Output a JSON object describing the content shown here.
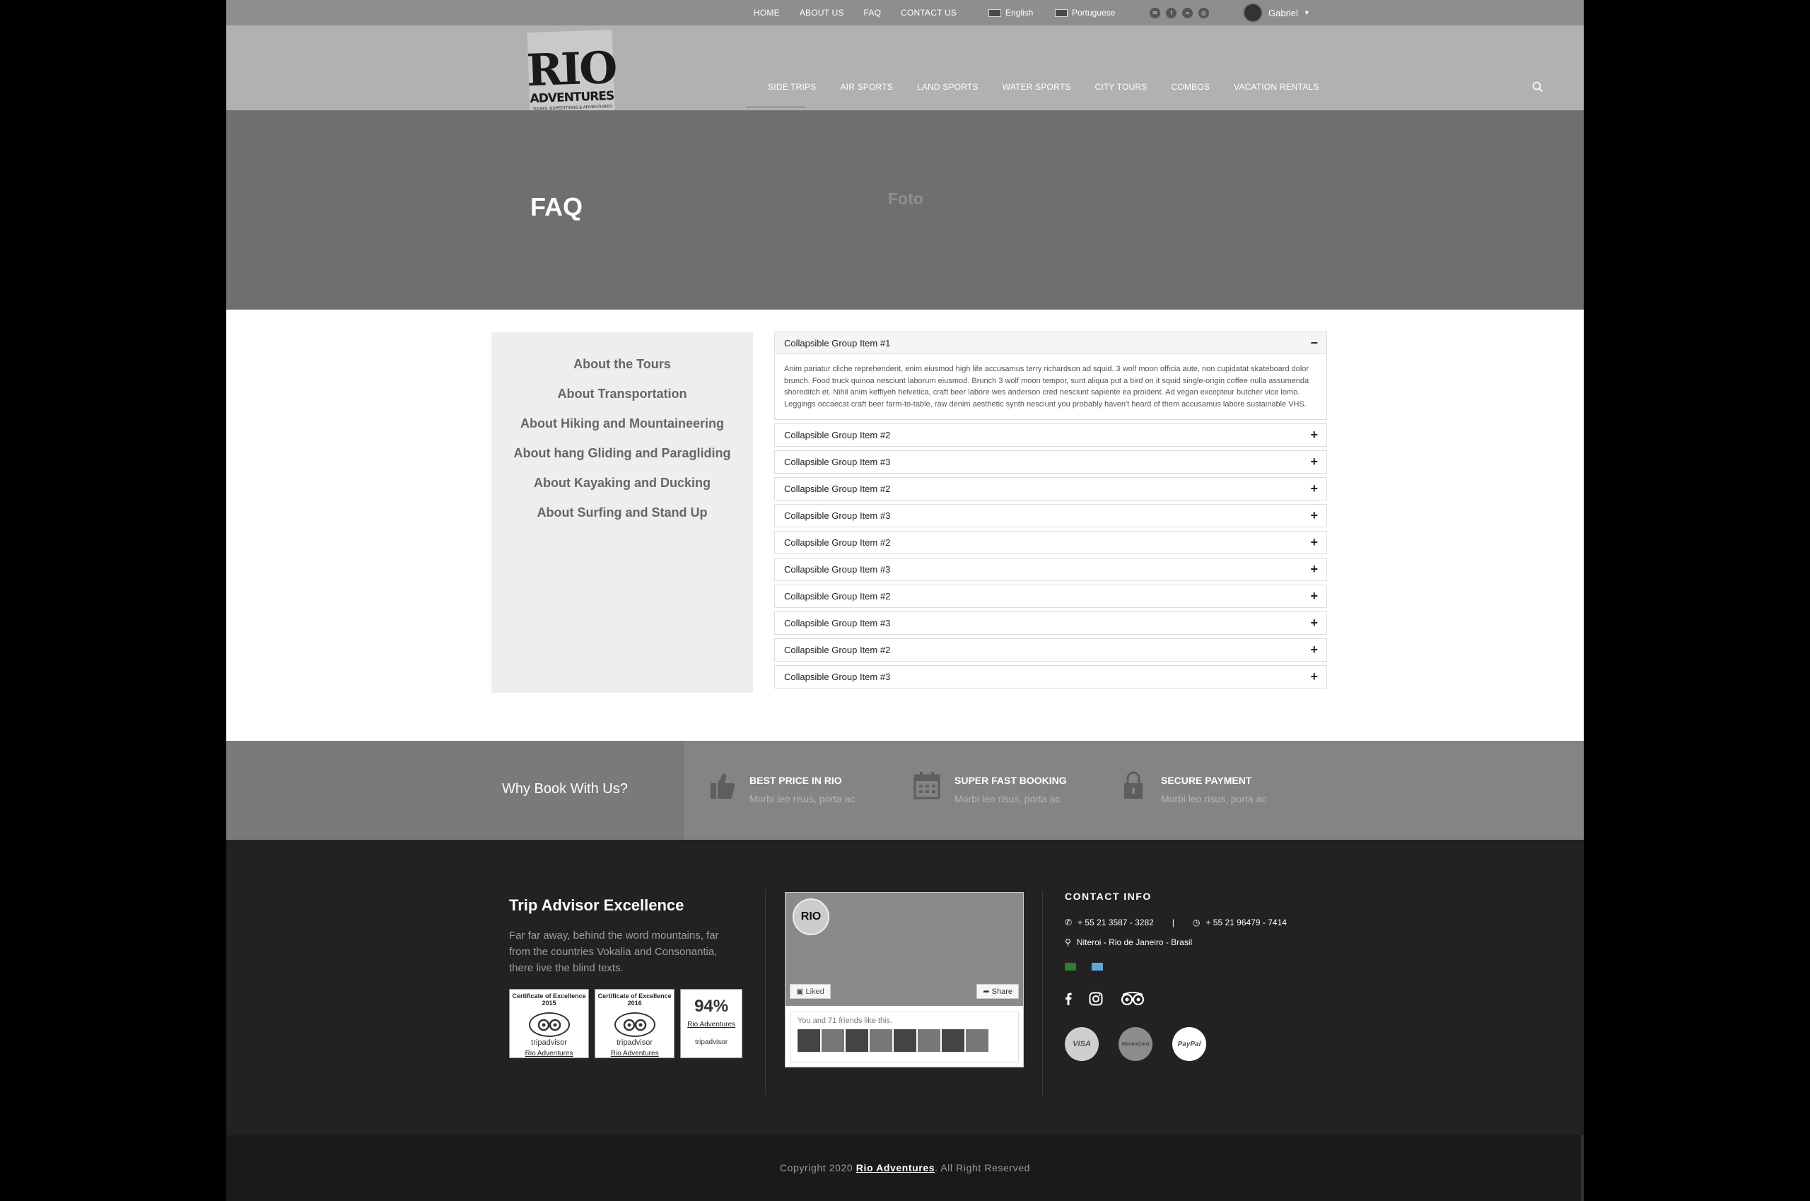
{
  "topbar": {
    "links": [
      "HOME",
      "ABOUT US",
      "FAQ",
      "CONTACT US"
    ],
    "lang_english": "English",
    "lang_portuguese": "Portuguese",
    "user_name": "Gabriel"
  },
  "logo": {
    "line1": "RIO",
    "line2": "ADVENTURES",
    "line3": "TOURS, EXPEDITIONS & ADVENTURES"
  },
  "nav": {
    "items": [
      "SIDE TRIPS",
      "AIR SPORTS",
      "LAND SPORTS",
      "WATER SPORTS",
      "CITY TOURS",
      "COMBOS",
      "VACATION RENTALS"
    ],
    "active": "SIDE TRIPS"
  },
  "hero": {
    "title": "FAQ",
    "image_placeholder": "Foto"
  },
  "sidebar": {
    "items": [
      "About the Tours",
      "About Transportation",
      "About Hiking and Mountaineering",
      "About hang Gliding and Paragliding",
      "About Kayaking and Ducking",
      "About Surfing and Stand Up"
    ]
  },
  "accordion": {
    "items": [
      {
        "title": "Collapsible Group Item #1",
        "open": true,
        "body": "Anim pariatur cliche reprehenderit, enim eiusmod high life accusamus terry richardson ad squid. 3 wolf moon officia aute, non cupidatat skateboard dolor brunch. Food truck quinoa nesciunt laborum eiusmod. Brunch 3 wolf moon tempor, sunt aliqua put a bird on it squid single-origin coffee nulla assumenda shoreditch et. Nihil anim keffiyeh helvetica, craft beer labore wes anderson cred nesciunt sapiente ea proident. Ad vegan excepteur butcher vice lomo. Leggings occaecat craft beer farm-to-table, raw denim aesthetic synth nesciunt you probably haven't heard of them accusamus labore sustainable VHS."
      },
      {
        "title": "Collapsible Group Item #2",
        "open": false
      },
      {
        "title": "Collapsible Group Item #3",
        "open": false
      },
      {
        "title": "Collapsible Group Item #2",
        "open": false
      },
      {
        "title": "Collapsible Group Item #3",
        "open": false
      },
      {
        "title": "Collapsible Group Item #2",
        "open": false
      },
      {
        "title": "Collapsible Group Item #3",
        "open": false
      },
      {
        "title": "Collapsible Group Item #2",
        "open": false
      },
      {
        "title": "Collapsible Group Item #3",
        "open": false
      },
      {
        "title": "Collapsible Group Item #2",
        "open": false
      },
      {
        "title": "Collapsible Group Item #3",
        "open": false
      }
    ],
    "open_symbol": "−",
    "closed_symbol": "+"
  },
  "whybook": {
    "title": "Why Book With Us?",
    "features": [
      {
        "name": "BEST PRICE IN RIO",
        "desc": "Morbi leo risus, porta ac",
        "icon": "thumbs-up-icon"
      },
      {
        "name": "SUPER FAST BOOKING",
        "desc": "Morbi leo risus, porta ac",
        "icon": "calendar-icon"
      },
      {
        "name": "SECURE PAYMENT",
        "desc": "Morbi leo risus, porta ac",
        "icon": "lock-icon"
      }
    ]
  },
  "footer": {
    "tripadvisor": {
      "title": "Trip Advisor Excellence",
      "text": "Far far away, behind the word mountains, far from the countries Vokalia and Consonantia, there live the blind texts.",
      "badges": [
        {
          "title": "Certificate of Excellence",
          "year": "2015",
          "brand": "tripadvisor",
          "link": "Rio Adventures"
        },
        {
          "title": "Certificate of Excellence",
          "year": "2016",
          "brand": "tripadvisor",
          "link": "Rio Adventures"
        },
        {
          "percent": "94%",
          "link": "Rio Adventures",
          "brand": "tripadvisor"
        }
      ]
    },
    "facebook": {
      "liked": "Liked",
      "share": "Share",
      "friends_text": "You and 71 friends like this.",
      "page_logo": "RIO"
    },
    "contact": {
      "heading": "CONTACT INFO",
      "phone": "+ 55 21 3587 - 3282",
      "separator": "|",
      "whatsapp": "+ 55 21 96479 - 7414",
      "address": "Niteroi - Rio de Janeiro - Brasil",
      "payments": [
        "VISA",
        "MasterCard",
        "PayPal"
      ]
    },
    "copyright_prefix": "Copyright 2020",
    "copyright_brand": "Rio Adventures",
    "copyright_suffix": ". All Right Reserved"
  }
}
